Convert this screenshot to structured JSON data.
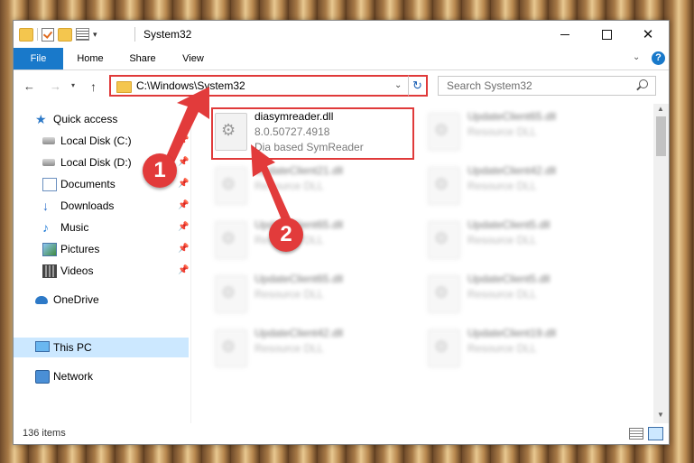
{
  "window": {
    "title": "System32",
    "buttons": {
      "minimize": "—",
      "maximize": "□",
      "close": "✕"
    }
  },
  "ribbon": {
    "tabs": [
      "File",
      "Home",
      "Share",
      "View"
    ],
    "help": "?"
  },
  "address": {
    "path": "C:\\Windows\\System32",
    "search_placeholder": "Search System32"
  },
  "sidebar": {
    "quick_access": "Quick access",
    "items": [
      {
        "label": "Local Disk (C:)",
        "icon": "drive-icon"
      },
      {
        "label": "Local Disk (D:)",
        "icon": "drive-icon"
      },
      {
        "label": "Documents",
        "icon": "documents-icon"
      },
      {
        "label": "Downloads",
        "icon": "downloads-icon"
      },
      {
        "label": "Music",
        "icon": "music-icon"
      },
      {
        "label": "Pictures",
        "icon": "pictures-icon"
      },
      {
        "label": "Videos",
        "icon": "videos-icon"
      }
    ],
    "onedrive": "OneDrive",
    "this_pc": "This PC",
    "network": "Network"
  },
  "files": {
    "selected": {
      "name": "diasymreader.dll",
      "version": "8.0.50727.4918",
      "description": "Dia based SymReader"
    },
    "blurred": [
      {
        "name": "UpdateClient65.dll",
        "type": "Resource DLL"
      },
      {
        "name": "UpdateClient21.dll",
        "type": "Resource DLL"
      },
      {
        "name": "UpdateClient42.dll",
        "type": "Resource DLL"
      },
      {
        "name": "UpdateClient65.dll",
        "type": "Resource DLL"
      },
      {
        "name": "UpdateClient5.dll",
        "type": "Resource DLL"
      },
      {
        "name": "UpdateClient65.dll",
        "type": "Resource DLL"
      },
      {
        "name": "UpdateClient5.dll",
        "type": "Resource DLL"
      },
      {
        "name": "UpdateClient42.dll",
        "type": "Resource DLL"
      },
      {
        "name": "UpdateClient19.dll",
        "type": "Resource DLL"
      }
    ]
  },
  "status": {
    "count": "136 items"
  },
  "callouts": [
    "1",
    "2"
  ],
  "colors": {
    "accent": "#1979ca",
    "highlight": "#e03a3a",
    "selection": "#cce8ff"
  }
}
